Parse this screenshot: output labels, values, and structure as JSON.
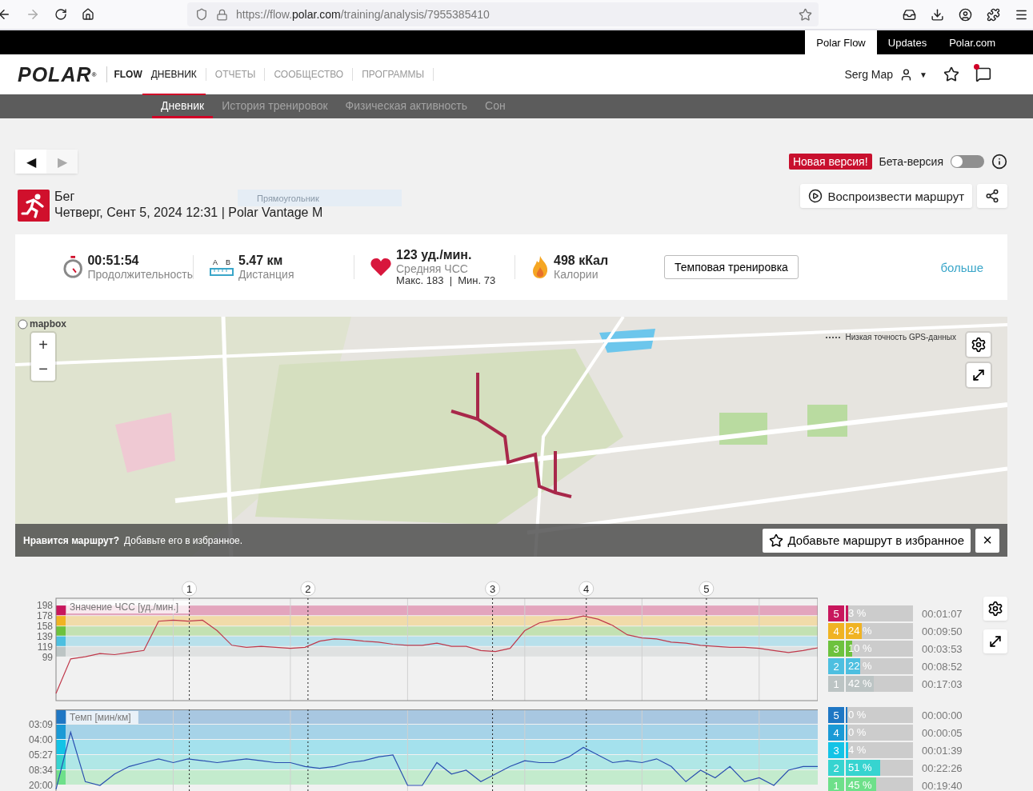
{
  "browser": {
    "url": "https://flow.**polar.com**/training/analysis/7955385410"
  },
  "top_links": [
    {
      "label": "Polar Flow",
      "selected": true
    },
    {
      "label": "Updates",
      "selected": false
    },
    {
      "label": "Polar.com",
      "selected": false
    }
  ],
  "header": {
    "logo": "POLAR$^{®}$",
    "product": "FLOW",
    "nav": [
      {
        "label": "ДНЕВНИК",
        "selected": true
      },
      {
        "label": "ОТЧЕТЫ",
        "selected": false
      },
      {
        "label": "СООБЩЕСТВО",
        "selected": false
      },
      {
        "label": "ПРОГРАММЫ",
        "selected": false
      }
    ],
    "user": "Serg Map",
    "caret": "▼",
    "notification": true
  },
  "subnav": [
    {
      "label": "Дневник",
      "selected": true
    },
    {
      "label": "История тренировок",
      "selected": false
    },
    {
      "label": "Физическая активность",
      "selected": false
    },
    {
      "label": "Сон",
      "selected": false
    }
  ],
  "pager": [
    {
      "symbol": "◀",
      "disabled": false
    },
    {
      "symbol": "▶",
      "disabled": true
    }
  ],
  "beta": {
    "badge": "Новая версия!",
    "label": "Бета-версия",
    "on": false
  },
  "activity": {
    "sport": "Бег",
    "details": "Четверг, Сент 5, 2024 12:31 | Polar Vantage M",
    "ghost_label": "Прямоугольник"
  },
  "actions": {
    "replay": "Воспроизвести маршрут"
  },
  "summary": {
    "stats": [
      {
        "kind": "duration",
        "value": "00:51:54",
        "label": "Продолжительность"
      },
      {
        "kind": "distance",
        "value": "5.47 км",
        "label": "Дистанция",
        "marks": [
          "A",
          "B"
        ]
      },
      {
        "kind": "heart_rate",
        "value": "123 уд./мин.",
        "label": "Средняя ЧСС",
        "extra": "Макс. 183  |  Мин. 73"
      },
      {
        "kind": "calories",
        "value": "498 кКал",
        "label": "Калории"
      }
    ],
    "training_type": "Темповая тренировка",
    "more": "больше"
  },
  "map": {
    "logo": "mapbox",
    "zoom_in": "+",
    "zoom_out": "−",
    "gps_legend": "Низкая точность GPS-данных",
    "prompt_title": "Нравится маршрут?",
    "prompt_text": "Добавьте его в избранное.",
    "favorite_button": "Добавьте маршрут в избранное",
    "close": "×"
  },
  "charts": {
    "hr": {
      "chart_data": {
        "type": "line",
        "title": "Значение ЧСС [уд./мин.]",
        "categories": [
          null,
          null,
          null,
          null,
          null,
          null,
          null,
          null,
          null,
          null,
          null,
          null,
          null,
          null,
          null,
          null,
          null,
          null,
          null,
          null,
          null,
          null,
          null,
          null,
          null,
          null,
          null,
          null,
          null,
          null,
          null,
          null,
          null,
          null,
          null,
          null,
          null,
          null,
          null,
          null,
          null,
          null,
          null,
          null,
          null,
          null,
          null,
          null,
          null,
          null,
          null,
          null,
          null
        ],
        "series": [
          {
            "color": "#c0394b",
            "values": [
              30,
              96,
              100,
              106,
              104,
              108,
              112,
              168,
              170,
              168,
              170,
              150,
              122,
              118,
              120,
              118,
              116,
              118,
              130,
              134,
              133,
              130,
              128,
              124,
              122,
              122,
              126,
              120,
              120,
              112,
              110,
              116,
              150,
              165,
              170,
              172,
              178,
              172,
              160,
              142,
              136,
              134,
              128,
              126,
              122,
              120,
              118,
              118,
              116,
              112,
              108,
              112,
              117
            ]
          }
        ],
        "ylim": [
          16,
          212
        ],
        "yticks": [
          99,
          119,
          139,
          158,
          178,
          198
        ],
        "grid": true
      },
      "laps": [
        {
          "label": "1"
        },
        {
          "label": "2"
        },
        {
          "label": "3"
        },
        {
          "label": "4"
        },
        {
          "label": "5"
        }
      ],
      "zones": [
        {
          "number": "5",
          "percent": "3 %",
          "time": "00:01:07",
          "color": "#c8175d",
          "level": 0.03
        },
        {
          "number": "4",
          "percent": "24 %",
          "time": "00:09:50",
          "color": "#f0b323",
          "level": 0.24
        },
        {
          "number": "3",
          "percent": "10 %",
          "time": "00:03:53",
          "color": "#6dc23d",
          "level": 0.1
        },
        {
          "number": "2",
          "percent": "22 %",
          "time": "00:08:52",
          "color": "#4dbfe0",
          "level": 0.22
        },
        {
          "number": "1",
          "percent": "42 %",
          "time": "00:17:03",
          "color": "#bcc4c4",
          "level": 0.42
        }
      ]
    },
    "pace": {
      "title": "Темп [мин/км]",
      "tick_labels": [
        "03:09",
        "04:00",
        "05:27",
        "08:34",
        "20:00"
      ],
      "zones": [
        {
          "number": "5",
          "percent": "0 %",
          "time": "00:00:00",
          "color": "#1f77c4",
          "level": 0
        },
        {
          "number": "4",
          "percent": "0 %",
          "time": "00:00:05",
          "color": "#1a9ad6",
          "level": 0
        },
        {
          "number": "3",
          "percent": "4 %",
          "time": "00:01:39",
          "color": "#13c3e6",
          "level": 0.04
        },
        {
          "number": "2",
          "percent": "51 %",
          "time": "00:22:26",
          "color": "#36d4d0",
          "level": 0.51
        },
        {
          "number": "1",
          "percent": "45 %",
          "time": "00:19:40",
          "color": "#6ee08a",
          "level": 0.45
        }
      ]
    }
  }
}
